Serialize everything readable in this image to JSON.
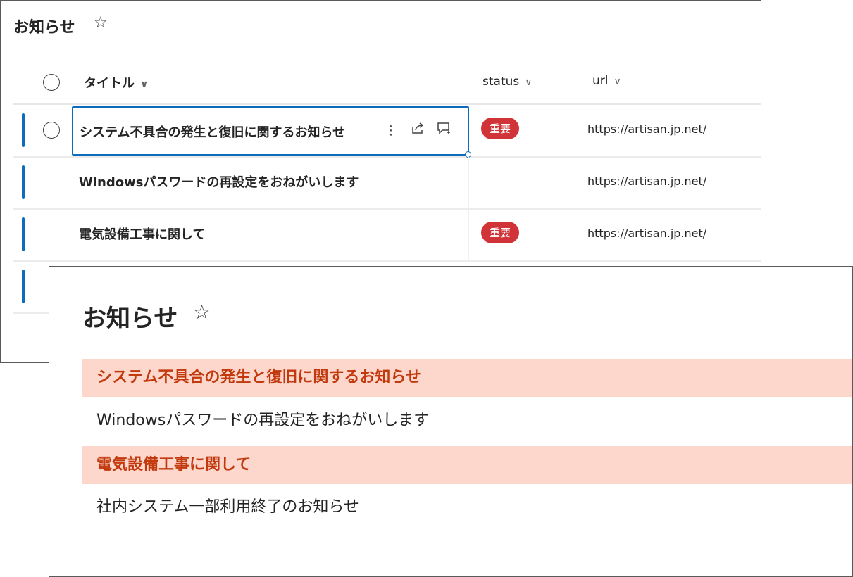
{
  "list_view": {
    "title": "お知らせ",
    "star_icon": "☆",
    "columns": {
      "title": "タイトル",
      "status": "status",
      "url": "url",
      "chevron": "∨"
    },
    "rows": [
      {
        "title": "システム不具合の発生と復旧に関するお知らせ",
        "status": "重要",
        "url": "https://artisan.jp.net/"
      },
      {
        "title": "Windowsパスワードの再設定をおねがいします",
        "status": "",
        "url": "https://artisan.jp.net/"
      },
      {
        "title": "電気設備工事に関して",
        "status": "重要",
        "url": "https://artisan.jp.net/"
      }
    ],
    "row_actions": {
      "more": "⋮",
      "share": "⇪",
      "comment": "▭"
    },
    "colors": {
      "accent": "#0f6cbd",
      "badge": "#d13438"
    }
  },
  "webpart": {
    "title": "お知らせ",
    "star_icon": "☆",
    "items": [
      {
        "text": "システム不具合の発生と復旧に関するお知らせ",
        "important": true
      },
      {
        "text": "Windowsパスワードの再設定をおねがいします",
        "important": false
      },
      {
        "text": "電気設備工事に関して",
        "important": true
      },
      {
        "text": "社内システム一部利用終了のお知らせ",
        "important": false
      }
    ],
    "colors": {
      "highlight_bg": "#fdd7cc",
      "highlight_text": "#c2390e"
    }
  }
}
